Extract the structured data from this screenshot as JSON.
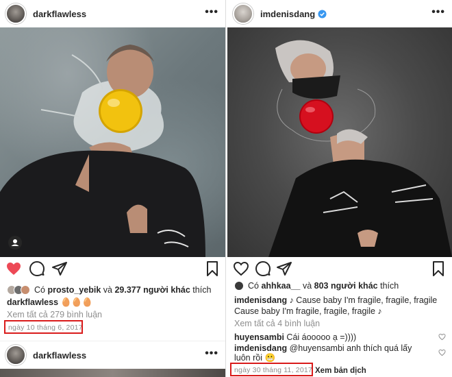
{
  "left_post": {
    "username": "darkflawless",
    "more": "•••",
    "liked_by_prefix": "Có",
    "liked_by_user": "prosto_yebik",
    "liked_by_and": "và",
    "liked_by_count": "29.377 người khác",
    "liked_by_suffix": "thích",
    "caption_user": "darkflawless",
    "caption_text": "🥚🥚🥚",
    "view_comments": "Xem tất cả 279 bình luận",
    "date": "ngày 10 tháng 6, 2017",
    "next_post_username": "darkflawless",
    "next_post_more": "•••"
  },
  "right_post": {
    "username": "imdenisdang",
    "more": "•••",
    "liked_by_prefix": "Có",
    "liked_by_user": "ahhkaa__",
    "liked_by_and": "và",
    "liked_by_count": "803 người khác",
    "liked_by_suffix": "thích",
    "caption_user": "imdenisdang",
    "caption_line1": "♪ Cause baby I'm fragile, fragile, fragile",
    "caption_line2": "Cause baby I'm fragile, fragile, fragile ♪",
    "view_comments": "Xem tất cả 4 bình luận",
    "comment1_user": "huyensambi",
    "comment1_text": "Cái áooooo ạ =))))",
    "comment2_user": "imdenisdang",
    "comment2_text_line1": "@huyensambi  anh thích quá lấy",
    "comment2_text_line2": "luôn rồi 😬",
    "date": "ngày 30 tháng 11, 2017",
    "translate": "Xem bản dịch"
  },
  "colors": {
    "heart_liked": "#ed4956",
    "highlight_box": "#d91a1a",
    "verified_badge": "#3897f0"
  },
  "icons": [
    "heart-icon",
    "comment-icon",
    "share-icon",
    "bookmark-icon",
    "user-tag-icon",
    "verified-icon",
    "more-icon"
  ]
}
